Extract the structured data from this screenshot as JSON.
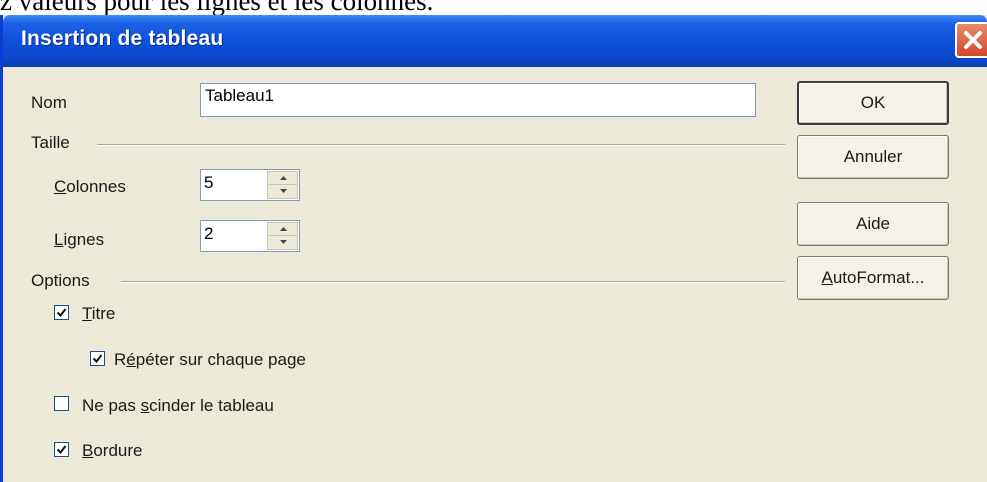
{
  "background_text": "z valeurs pour les lignes et les colonnes.",
  "dialog": {
    "title": "Insertion de tableau",
    "close_icon": "close-icon"
  },
  "form": {
    "name_label": "Nom",
    "name_value": "Tableau1",
    "size_section": "Taille",
    "columns_label": "Colonnes",
    "columns_value": "5",
    "rows_label": "Lignes",
    "rows_value": "2",
    "options_section": "Options",
    "options": [
      {
        "label": "Titre",
        "checked": true
      },
      {
        "label": "Répéter sur chaque page",
        "checked": true
      },
      {
        "label": "Ne pas scinder le tableau",
        "checked": false
      },
      {
        "label": "Bordure",
        "checked": true
      }
    ]
  },
  "buttons": {
    "ok": "OK",
    "cancel": "Annuler",
    "help": "Aide",
    "autoformat": "AutoFormat..."
  },
  "colors": {
    "titlebar": "#0b48c9",
    "dialog_bg": "#ece9d8",
    "close_button": "#d3472a"
  }
}
